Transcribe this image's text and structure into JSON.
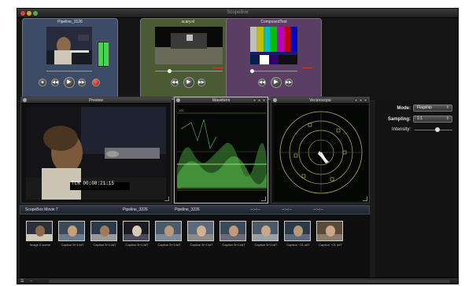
{
  "window": {
    "title": "ScopeBox"
  },
  "sources": [
    {
      "title": "Pipeline_3126",
      "color": "#3d4c66"
    },
    {
      "title": "scary.nl",
      "color": "#4a5a33"
    },
    {
      "title": "ComposedTest",
      "color": "#5a3e63"
    }
  ],
  "transport": {
    "stop_icon": "stop-icon",
    "rewind_icon": "rewind-icon",
    "play_icon": "play-icon",
    "forward_icon": "fast-forward-icon",
    "record_icon": "record-icon"
  },
  "panels": {
    "preview": {
      "title": "Preview",
      "timecode": "TCR 00:08:21:15"
    },
    "waveform": {
      "title": "Waveform",
      "scale": [
        "100",
        "0"
      ]
    },
    "vectorscope": {
      "title": "Vectorscope"
    }
  },
  "inspector": {
    "mode_label": "Mode:",
    "mode_value": "Flagship",
    "sampling_label": "Sampling:",
    "sampling_value": "1:1",
    "intensity_label": "Intensity:",
    "intensity_level": 0.6
  },
  "bin": {
    "name": "ScopeBox Movie 7",
    "col2": "Pipeline_3226",
    "col3": "Pipeline_3226",
    "col4": "--:--:--",
    "col5": "--:--:--",
    "col6": "--:--:--"
  },
  "clips": [
    {
      "label": "Image A  scene"
    },
    {
      "label": "Caption  B+14dT"
    },
    {
      "label": "Caption  B+14dT"
    },
    {
      "label": "Caption  B+14dT"
    },
    {
      "label": "Caption  B+14dT"
    },
    {
      "label": "Caption  B+14dT"
    },
    {
      "label": "Caption  B+14dT"
    },
    {
      "label": "Caption  B+14dT"
    },
    {
      "label": "Caption  ~01.4dT"
    },
    {
      "label": "Caption  ~01.4dT"
    }
  ],
  "footer": {
    "menu_icon": "list-icon",
    "minus_icon": "minus-icon"
  }
}
